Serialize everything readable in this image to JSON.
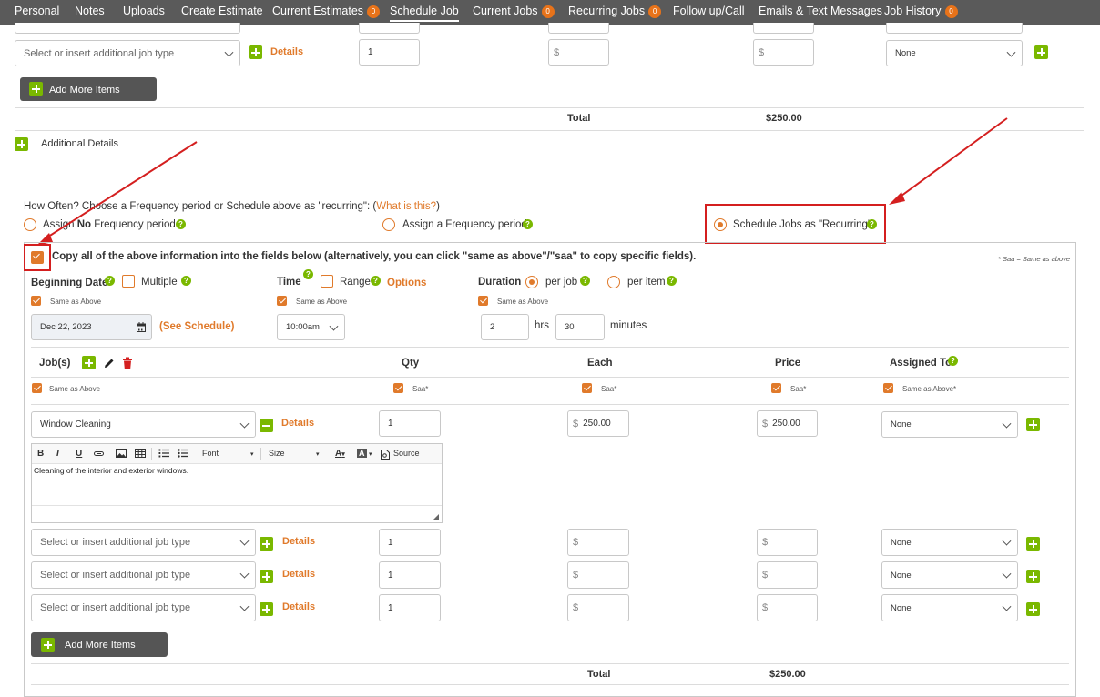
{
  "nav": {
    "items": [
      {
        "label": "Personal"
      },
      {
        "label": "Notes"
      },
      {
        "label": "Uploads"
      },
      {
        "label": "Create Estimate"
      },
      {
        "label": "Current Estimates",
        "badge": "0"
      },
      {
        "label": "Schedule Job",
        "active": true
      },
      {
        "label": "Current Jobs",
        "badge": "0"
      },
      {
        "label": "Recurring Jobs",
        "badge": "0"
      },
      {
        "label": "Follow up/Call"
      },
      {
        "label": "Emails & Text Messages"
      },
      {
        "label": "Job History",
        "badge": "0"
      }
    ]
  },
  "top_section": {
    "row": {
      "job_placeholder": "Select or insert additional job type",
      "details_label": "Details",
      "qty": "1",
      "each_currency": "$",
      "price_currency": "$",
      "assigned": "None"
    },
    "add_more_label": "Add More Items",
    "total_label": "Total",
    "total_value": "$250.00",
    "additional_details_label": "Additional Details"
  },
  "frequency": {
    "question": "How Often? Choose a Frequency period or Schedule above as \"recurring\": (",
    "question_link": "What is this?",
    "question_close": ")",
    "option_no_prefix": "Assign ",
    "option_no_bold": "No",
    "option_no_suffix": " Frequency period",
    "option_assign": "Assign a Frequency period",
    "option_recurring": "Schedule Jobs as \"Recurring\"",
    "selected": "recurring"
  },
  "copy_section": {
    "copy_text": "Copy all of the above information into the fields below (alternatively, you can click \"same as above\"/\"saa\" to copy specific fields).",
    "saa_note": "* Saa = Same as above",
    "beginning_date_label": "Beginning Date",
    "multiple_label": "Multiple",
    "same_as_above": "Same as Above",
    "date_value": "Dec 22, 2023",
    "see_schedule": "(See Schedule)",
    "time_label": "Time",
    "range_label": "Range",
    "options_label": "Options",
    "time_value": "10:00am",
    "duration_label": "Duration",
    "per_job_label": "per job",
    "per_item_label": "per item",
    "hours_value": "2",
    "hrs_label": "hrs",
    "minutes_value": "30",
    "minutes_label": "minutes"
  },
  "jobs_table": {
    "headers": {
      "jobs": "Job(s)",
      "qty": "Qty",
      "each": "Each",
      "price": "Price",
      "assigned": "Assigned To"
    },
    "saa": {
      "jobs": "Same as Above",
      "qty": "Saa*",
      "each": "Saa*",
      "price": "Saa*",
      "assigned": "Same as Above*"
    },
    "first_row": {
      "job": "Window Cleaning",
      "details_label": "Details",
      "qty": "1",
      "each_currency": "$",
      "each": "250.00",
      "price_currency": "$",
      "price": "250.00",
      "assigned": "None"
    },
    "editor": {
      "bold": "B",
      "italic": "I",
      "underline": "U",
      "font_label": "Font",
      "size_label": "Size",
      "source_label": "Source",
      "text_color": "A",
      "bg_color": "A",
      "content": "Cleaning of the interior and exterior windows."
    },
    "extra_rows": [
      {
        "job_placeholder": "Select or insert additional job type",
        "details_label": "Details",
        "qty": "1",
        "each_currency": "$",
        "price_currency": "$",
        "assigned": "None"
      },
      {
        "job_placeholder": "Select or insert additional job type",
        "details_label": "Details",
        "qty": "1",
        "each_currency": "$",
        "price_currency": "$",
        "assigned": "None"
      },
      {
        "job_placeholder": "Select or insert additional job type",
        "details_label": "Details",
        "qty": "1",
        "each_currency": "$",
        "price_currency": "$",
        "assigned": "None"
      }
    ],
    "add_more_label": "Add More Items",
    "total_label": "Total",
    "total_value": "$250.00"
  },
  "colors": {
    "accent_orange": "#e07a2b",
    "accent_green": "#7ab800",
    "nav_bg": "#5a5a5a",
    "annotation_red": "#d41f1f"
  }
}
